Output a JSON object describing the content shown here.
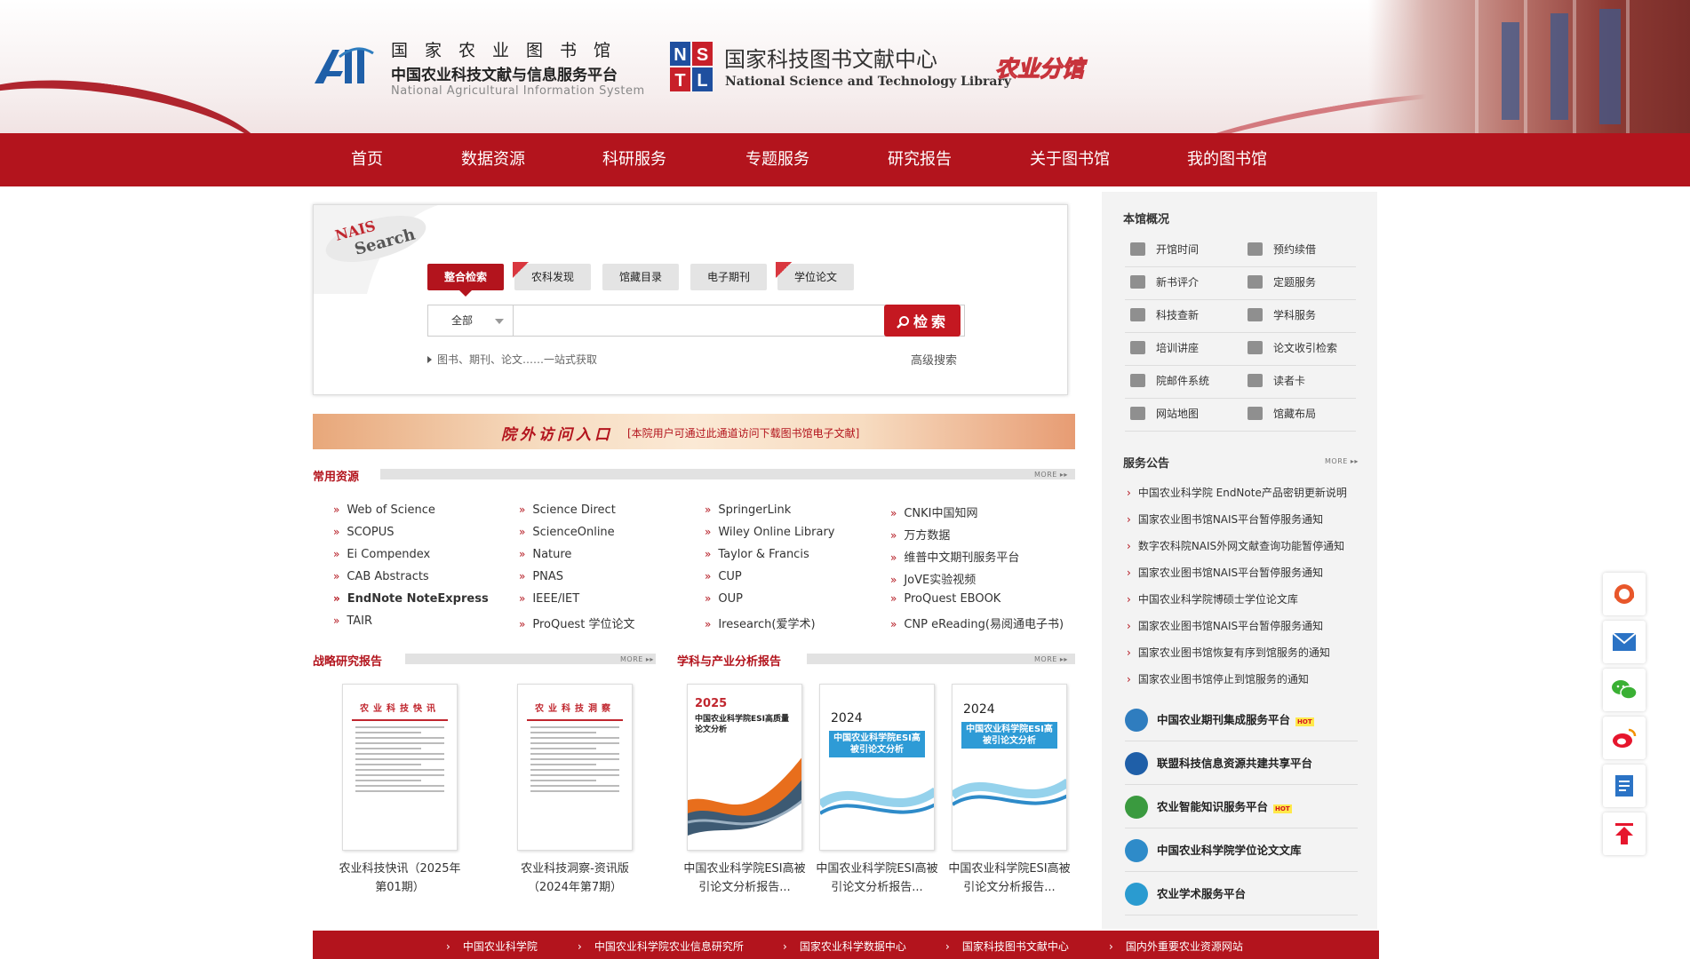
{
  "header": {
    "org_name": "国家农业图书馆",
    "org_sub": "中国农业科技文献与信息服务平台",
    "org_en": "National Agricultural Information System",
    "nstl_cn": "国家科技图书文献中心",
    "nstl_en": "National Science and Technology Library",
    "branch": "农业分馆",
    "logo_text": "AII",
    "nstl_letters": [
      "N",
      "S",
      "T",
      "L"
    ]
  },
  "nav": [
    "首页",
    "数据资源",
    "科研服务",
    "专题服务",
    "研究报告",
    "关于图书馆",
    "我的图书馆"
  ],
  "search": {
    "badge_top": "NAIS",
    "badge_bottom": "Search",
    "tabs": [
      {
        "label": "整合检索",
        "active": true,
        "new": false
      },
      {
        "label": "农科发现",
        "active": false,
        "new": true
      },
      {
        "label": "馆藏目录",
        "active": false,
        "new": false
      },
      {
        "label": "电子期刊",
        "active": false,
        "new": false
      },
      {
        "label": "学位论文",
        "active": false,
        "new": true
      }
    ],
    "scope": "全部",
    "query": "",
    "button": "检索",
    "hint": "图书、期刊、论文……一站式获取",
    "advanced": "高级搜索"
  },
  "banner": {
    "title": "院外访问入口",
    "note": "[本院用户可通过此通道访问下载图书馆电子文献]"
  },
  "resources": {
    "title": "常用资源",
    "more": "MORE ▸▸",
    "columns": [
      [
        "Web of Science",
        "SCOPUS",
        "Ei Compendex",
        "CAB Abstracts",
        "EndNote  NoteExpress",
        "TAIR"
      ],
      [
        "Science Direct",
        "ScienceOnline",
        "Nature",
        "PNAS",
        "IEEE/IET",
        "ProQuest 学位论文"
      ],
      [
        "SpringerLink",
        "Wiley Online Library",
        "Taylor & Francis",
        "CUP",
        "OUP",
        "Iresearch(爱学术)"
      ],
      [
        "CNKI中国知网",
        "万方数据",
        "维普中文期刊服务平台",
        "JoVE实验视频",
        "ProQuest EBOOK",
        "CNP eReading(易阅通电子书)"
      ]
    ]
  },
  "reports": {
    "strategic_title": "战略研究报告",
    "analysis_title": "学科与产业分析报告",
    "more": "MORE ▸▸",
    "items": [
      {
        "label": "农业科技快讯（2025年第01期）",
        "cover_title": "农业科技快讯"
      },
      {
        "label": "农业科技洞察-资讯版（2024年第7期）",
        "cover_title": "农业科技洞察"
      },
      {
        "label": "中国农业科学院ESI高被引论文分析报告...",
        "cover_year": "2025",
        "cover_title": "中国农业科学院ESI高质量论文分析"
      },
      {
        "label": "中国农业科学院ESI高被引论文分析报告...",
        "cover_year": "2024",
        "cover_title": "中国农业科学院ESI高被引论文分析"
      },
      {
        "label": "中国农业科学院ESI高被引论文分析报告...",
        "cover_year": "2024",
        "cover_title": "中国农业科学院ESI高被引论文分析"
      }
    ]
  },
  "sidebar": {
    "overview_title": "本馆概况",
    "overview": [
      {
        "label": "开馆时间",
        "icon": "clock-icon"
      },
      {
        "label": "预约续借",
        "icon": "calendar-icon"
      },
      {
        "label": "新书评介",
        "icon": "book-icon"
      },
      {
        "label": "定题服务",
        "icon": "topic-icon"
      },
      {
        "label": "科技查新",
        "icon": "novelty-icon"
      },
      {
        "label": "学科服务",
        "icon": "subject-icon"
      },
      {
        "label": "培训讲座",
        "icon": "training-icon"
      },
      {
        "label": "论文收引检索",
        "icon": "citation-icon"
      },
      {
        "label": "院邮件系统",
        "icon": "mail-icon"
      },
      {
        "label": "读者卡",
        "icon": "card-icon"
      },
      {
        "label": "网站地图",
        "icon": "sitemap-icon"
      },
      {
        "label": "馆藏布局",
        "icon": "layout-icon"
      }
    ],
    "notice_title": "服务公告",
    "notice_more": "MORE ▸▸",
    "notices": [
      "中国农业科学院 EndNote产品密钥更新说明",
      "国家农业图书馆NAIS平台暂停服务通知",
      "数字农科院NAIS外网文献查询功能暂停通知",
      "国家农业图书馆NAIS平台暂停服务通知",
      "中国农业科学院博硕士学位论文库",
      "国家农业图书馆NAIS平台暂停服务通知",
      "国家农业图书馆恢复有序到馆服务的通知",
      "国家农业图书馆停止到馆服务的通知"
    ],
    "platforms": [
      {
        "label": "中国农业期刊集成服务平台",
        "hot": true,
        "color": "#2f7dbf"
      },
      {
        "label": "联盟科技信息资源共建共享平台",
        "hot": false,
        "color": "#1f5fa8"
      },
      {
        "label": "农业智能知识服务平台",
        "hot": true,
        "color": "#3a9a3f"
      },
      {
        "label": "中国农业科学院学位论文文库",
        "hot": false,
        "color": "#2e8bc9"
      },
      {
        "label": "农业学术服务平台",
        "hot": false,
        "color": "#2a9bd0"
      }
    ],
    "hot_label": "HOT"
  },
  "tools": [
    "service-chat-icon",
    "mail-icon",
    "wechat-icon",
    "weibo-icon",
    "notes-icon",
    "back-to-top-icon"
  ],
  "footer": [
    "中国农业科学院",
    "中国农业科学院农业信息研究所",
    "国家农业科学数据中心",
    "国家科技图书文献中心",
    "国内外重要农业资源网站"
  ],
  "colors": {
    "brand_red": "#b3141d",
    "sidebar_bg": "#f3f3f3"
  }
}
